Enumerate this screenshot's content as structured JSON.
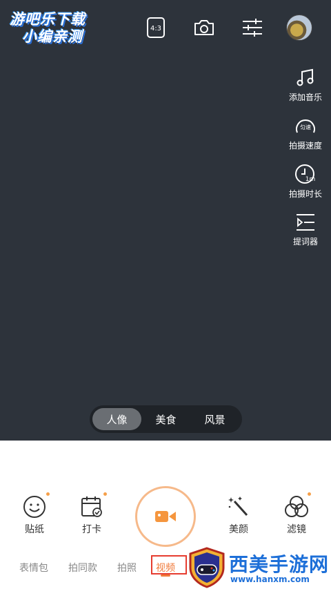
{
  "watermark_top": {
    "line1": "游吧乐下载",
    "line2": "小编亲测"
  },
  "top_bar": {
    "ratio_label": "4:3",
    "icons": [
      "aspect-ratio-icon",
      "switch-camera-icon",
      "settings-sliders-icon"
    ]
  },
  "side_tools": [
    {
      "label": "添加音乐",
      "icon": "music-note-icon"
    },
    {
      "label": "拍摄速度",
      "icon": "speed-icon",
      "badge": "匀速"
    },
    {
      "label": "拍摄时长",
      "icon": "duration-clock-icon",
      "badge": "1m"
    },
    {
      "label": "提词器",
      "icon": "teleprompter-icon"
    }
  ],
  "modes": [
    {
      "label": "人像",
      "active": true
    },
    {
      "label": "美食",
      "active": false
    },
    {
      "label": "风景",
      "active": false
    }
  ],
  "bottom_tools": {
    "sticker": "贴纸",
    "checkin": "打卡",
    "beauty": "美颜",
    "filter": "滤镜"
  },
  "capture_tabs": [
    {
      "label": "表情包"
    },
    {
      "label": "拍同款"
    },
    {
      "label": "拍照"
    },
    {
      "label": "视频",
      "active": true
    }
  ],
  "watermark_bottom": {
    "title": "西美手游网",
    "url": "www.hanxm.com"
  },
  "colors": {
    "accent": "#f07a3a",
    "viewfinder": "#2d333b",
    "watermark_blue": "#1d6fd8"
  }
}
